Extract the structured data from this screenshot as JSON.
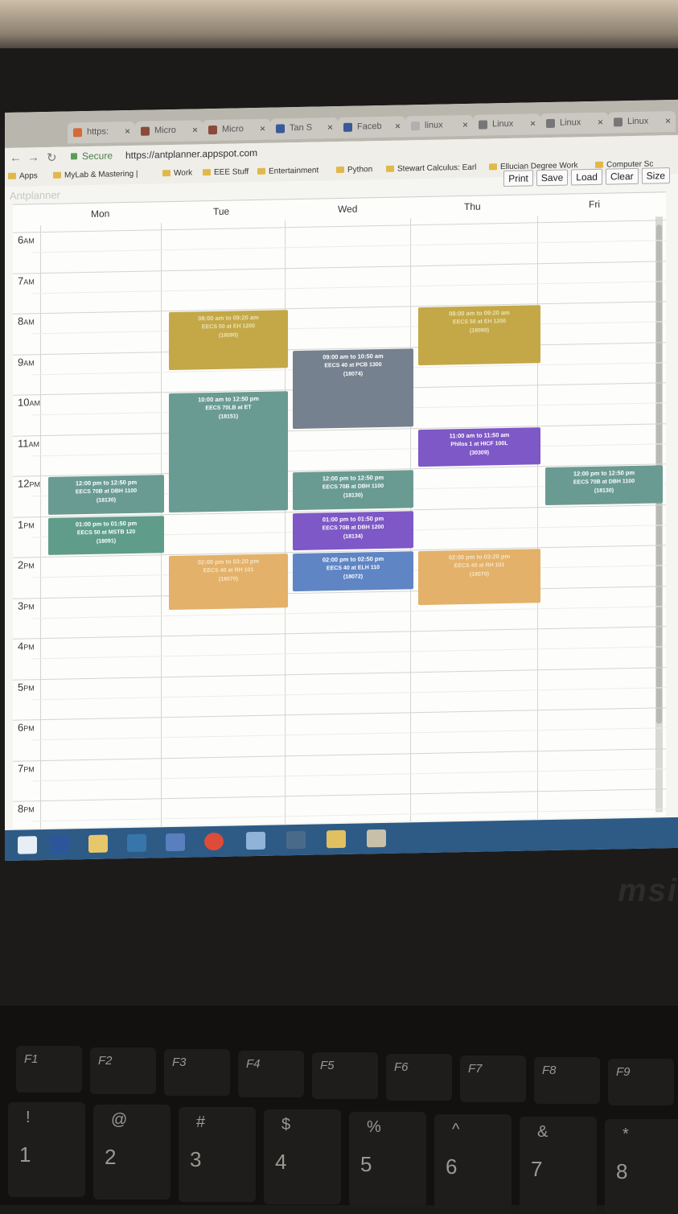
{
  "browser": {
    "tabs": [
      {
        "label": "https:",
        "color": "#d26b3a"
      },
      {
        "label": "Micro",
        "color": "#8a4a3a"
      },
      {
        "label": "Micro",
        "color": "#8a4a3a"
      },
      {
        "label": "Tan S",
        "color": "#3a5a9a"
      },
      {
        "label": "Faceb",
        "color": "#3b5998"
      },
      {
        "label": "linux",
        "color": "#b0b0b0"
      },
      {
        "label": "Linux",
        "color": "#777"
      },
      {
        "label": "Linux",
        "color": "#777"
      },
      {
        "label": "Linux",
        "color": "#777"
      }
    ],
    "secure_label": "Secure",
    "url": "https://antplanner.appspot.com",
    "bookmarks": [
      "Apps",
      "MyLab & Mastering |",
      "Work",
      "EEE Stuff",
      "Entertainment",
      "Python",
      "Stewart Calculus: Earl",
      "Ellucian Degree Work",
      "Computer Sc"
    ]
  },
  "app": {
    "logo": "Antplanner",
    "toolbar": {
      "print": "Print",
      "save": "Save",
      "load": "Load",
      "clear": "Clear",
      "size": "Size"
    }
  },
  "calendar": {
    "days": [
      "Mon",
      "Tue",
      "Wed",
      "Thu",
      "Fri"
    ],
    "hours": [
      {
        "n": "6",
        "p": "AM"
      },
      {
        "n": "7",
        "p": "AM"
      },
      {
        "n": "8",
        "p": "AM"
      },
      {
        "n": "9",
        "p": "AM"
      },
      {
        "n": "10",
        "p": "AM"
      },
      {
        "n": "11",
        "p": "AM"
      },
      {
        "n": "12",
        "p": "PM"
      },
      {
        "n": "1",
        "p": "PM"
      },
      {
        "n": "2",
        "p": "PM"
      },
      {
        "n": "3",
        "p": "PM"
      },
      {
        "n": "4",
        "p": "PM"
      },
      {
        "n": "5",
        "p": "PM"
      },
      {
        "n": "6",
        "p": "PM"
      },
      {
        "n": "7",
        "p": "PM"
      },
      {
        "n": "8",
        "p": "PM"
      }
    ],
    "events": [
      {
        "day": 1,
        "start": 8.0,
        "end": 9.5,
        "color": "gold",
        "time": "08:00 am to 09:20 am",
        "course": "EECS 50 at EH 1200",
        "code": "(18090)"
      },
      {
        "day": 3,
        "start": 8.0,
        "end": 9.5,
        "color": "gold",
        "time": "08:00 am to 09:20 am",
        "course": "EECS 50 at EH 1200",
        "code": "(18090)"
      },
      {
        "day": 2,
        "start": 9.0,
        "end": 11.0,
        "color": "slate",
        "time": "09:00 am to 10:50 am",
        "course": "EECS 40 at PCB 1300",
        "code": "(18074)"
      },
      {
        "day": 1,
        "start": 10.0,
        "end": 13.0,
        "color": "teal",
        "time": "10:00 am to 12:50 pm",
        "course": "EECS 70LB at ET",
        "code": "(18151)"
      },
      {
        "day": 3,
        "start": 11.0,
        "end": 12.0,
        "color": "purple",
        "time": "11:00 am to 11:50 am",
        "course": "Philos 1 at HICF 100L",
        "code": "(30309)"
      },
      {
        "day": 0,
        "start": 12.0,
        "end": 13.0,
        "color": "teal",
        "time": "12:00 pm to 12:50 pm",
        "course": "EECS 70B at DBH 1100",
        "code": "(18130)"
      },
      {
        "day": 2,
        "start": 12.0,
        "end": 13.0,
        "color": "teal",
        "time": "12:00 pm to 12:50 pm",
        "course": "EECS 70B at DBH 1100",
        "code": "(18130)"
      },
      {
        "day": 4,
        "start": 12.0,
        "end": 13.0,
        "color": "teal",
        "time": "12:00 pm to 12:50 pm",
        "course": "EECS 70B at DBH 1100",
        "code": "(18130)"
      },
      {
        "day": 0,
        "start": 13.0,
        "end": 14.0,
        "color": "green",
        "time": "01:00 pm to 01:50 pm",
        "course": "EECS 50 at MSTB 120",
        "code": "(18091)"
      },
      {
        "day": 2,
        "start": 13.0,
        "end": 14.0,
        "color": "purple",
        "time": "01:00 pm to 01:50 pm",
        "course": "EECS 70B at DBH 1200",
        "code": "(18134)"
      },
      {
        "day": 1,
        "start": 14.0,
        "end": 15.4,
        "color": "orange",
        "time": "02:00 pm to 03:20 pm",
        "course": "EECS 40 at RH 101",
        "code": "(18070)"
      },
      {
        "day": 2,
        "start": 14.0,
        "end": 15.0,
        "color": "blue",
        "time": "02:00 pm to 02:50 pm",
        "course": "EECS 40 at ELH 110",
        "code": "(18072)"
      },
      {
        "day": 3,
        "start": 14.0,
        "end": 15.4,
        "color": "orange",
        "time": "02:00 pm to 03:20 pm",
        "course": "EECS 40 at RH 101",
        "code": "(18070)"
      }
    ]
  },
  "taskbar": {
    "icons": [
      "windows-start",
      "word",
      "file-explorer",
      "python",
      "network",
      "chrome",
      "app",
      "photos",
      "maps",
      "paint"
    ]
  },
  "laptop": {
    "brand": "msi",
    "fkeys": [
      "F1",
      "F2",
      "F3",
      "F4",
      "F5",
      "F6",
      "F7",
      "F8",
      "F9"
    ],
    "numkeys": [
      {
        "n": "1",
        "s": "!"
      },
      {
        "n": "2",
        "s": "@"
      },
      {
        "n": "3",
        "s": "#"
      },
      {
        "n": "4",
        "s": "$"
      },
      {
        "n": "5",
        "s": "%"
      },
      {
        "n": "6",
        "s": "^"
      },
      {
        "n": "7",
        "s": "&"
      },
      {
        "n": "8",
        "s": "*"
      }
    ]
  }
}
